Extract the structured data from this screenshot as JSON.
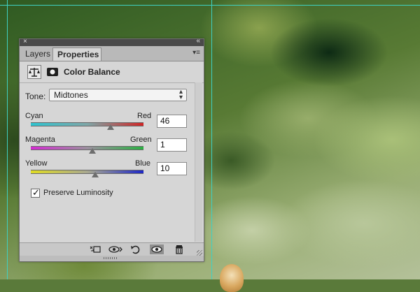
{
  "tabs": {
    "layers": "Layers",
    "properties": "Properties"
  },
  "adjustment": {
    "title": "Color Balance"
  },
  "tone": {
    "label": "Tone:",
    "selected": "Midtones"
  },
  "sliders": [
    {
      "left_label": "Cyan",
      "right_label": "Red",
      "value": "46",
      "position_fraction": 0.71
    },
    {
      "left_label": "Magenta",
      "right_label": "Green",
      "value": "1",
      "position_fraction": 0.545
    },
    {
      "left_label": "Yellow",
      "right_label": "Blue",
      "value": "10",
      "position_fraction": 0.57
    }
  ],
  "preserve_luminosity": {
    "label": "Preserve Luminosity",
    "checked": true
  },
  "icons": {
    "close": "close-icon",
    "collapse": "collapse-icon",
    "panel_menu": "panel-menu-icon",
    "adjustment": "color-balance-scale-icon",
    "mask": "layer-mask-icon",
    "clip": "clip-to-layer-icon",
    "view_previous": "view-previous-state-icon",
    "reset": "reset-icon",
    "visibility": "eye-icon",
    "delete": "trash-icon"
  },
  "colors": {
    "guide": "#3fd1c2",
    "panel_bg": "#d6d6d6"
  }
}
